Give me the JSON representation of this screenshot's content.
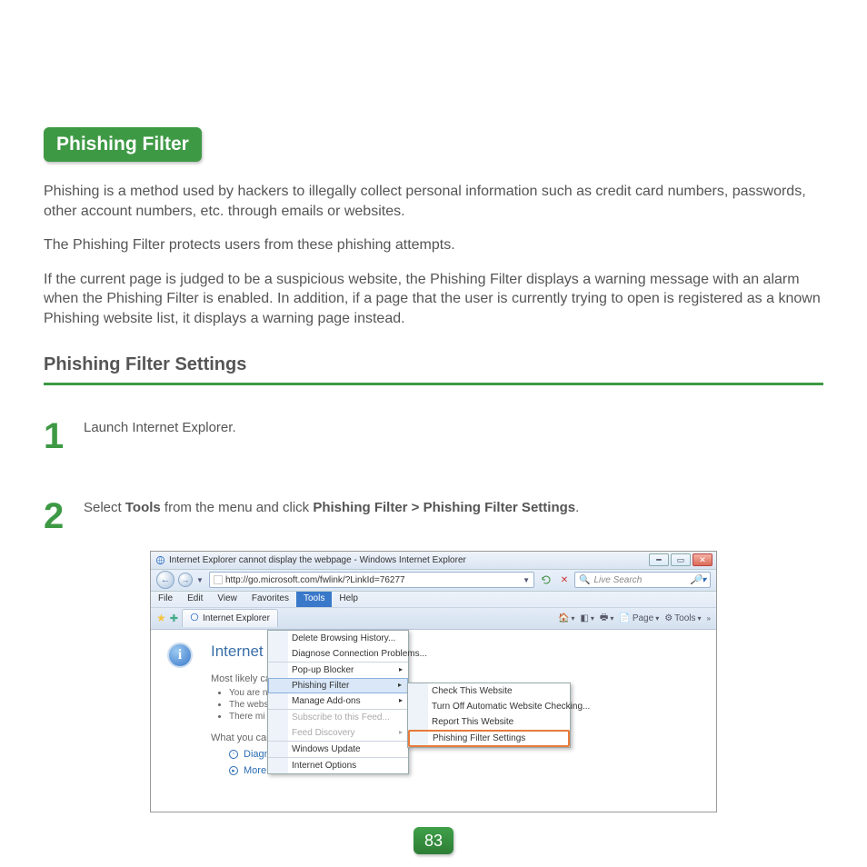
{
  "page_number": "83",
  "section_title": "Phishing Filter",
  "intro_paragraphs": [
    "Phishing is a method used by hackers to illegally collect personal information such as credit card numbers, passwords, other account numbers, etc. through emails or websites.",
    "The Phishing Filter protects users from these phishing attempts.",
    "If the current page is judged to be a suspicious website, the Phishing Filter displays a warning message with an alarm when the Phishing Filter is enabled. In addition, if a page that the user is currently trying to open is registered as a known Phishing website list, it displays a warning page instead."
  ],
  "settings_heading": "Phishing Filter Settings",
  "steps": [
    {
      "num": "1",
      "text_plain": "Launch Internet Explorer."
    },
    {
      "num": "2",
      "prefix": "Select ",
      "bold1": "Tools",
      "mid": " from the menu and click ",
      "bold2": "Phishing Filter > Phishing Filter Settings",
      "suffix": "."
    }
  ],
  "ie": {
    "title": "Internet Explorer cannot display the webpage - Windows Internet Explorer",
    "url": "http://go.microsoft.com/fwlink/?LinkId=76277",
    "search_placeholder": "Live Search",
    "menubar": [
      "File",
      "Edit",
      "View",
      "Favorites",
      "Tools",
      "Help"
    ],
    "active_menu": "Tools",
    "tab_label": "Internet Explorer ",
    "toolbar_right": {
      "page": "Page",
      "tools": "Tools"
    },
    "content": {
      "heading": "Internet Exp",
      "likely_label": "Most likely caus",
      "bullets": [
        "You are n",
        "The webs",
        "There mi"
      ],
      "try_label": "What you can t",
      "links": [
        "Diagnose Connection Problems",
        "More information"
      ]
    },
    "tools_menu": [
      {
        "label": "Delete Browsing History...",
        "sep": false
      },
      {
        "label": "Diagnose Connection Problems...",
        "sep": false
      },
      {
        "label": "Pop-up Blocker",
        "sep": true,
        "sub": true
      },
      {
        "label": "Phishing Filter",
        "sep": false,
        "sub": true,
        "hl": true
      },
      {
        "label": "Manage Add-ons",
        "sep": false,
        "sub": true
      },
      {
        "label": "Subscribe to this Feed...",
        "sep": true,
        "disabled": true
      },
      {
        "label": "Feed Discovery",
        "sep": false,
        "disabled": true,
        "sub": true
      },
      {
        "label": "Windows Update",
        "sep": true
      },
      {
        "label": "Internet Options",
        "sep": true
      }
    ],
    "phishing_submenu": [
      {
        "label": "Check This Website"
      },
      {
        "label": "Turn Off Automatic Website Checking..."
      },
      {
        "label": "Report This Website"
      },
      {
        "label": "Phishing Filter Settings",
        "sep": true,
        "boxed": true
      }
    ]
  }
}
